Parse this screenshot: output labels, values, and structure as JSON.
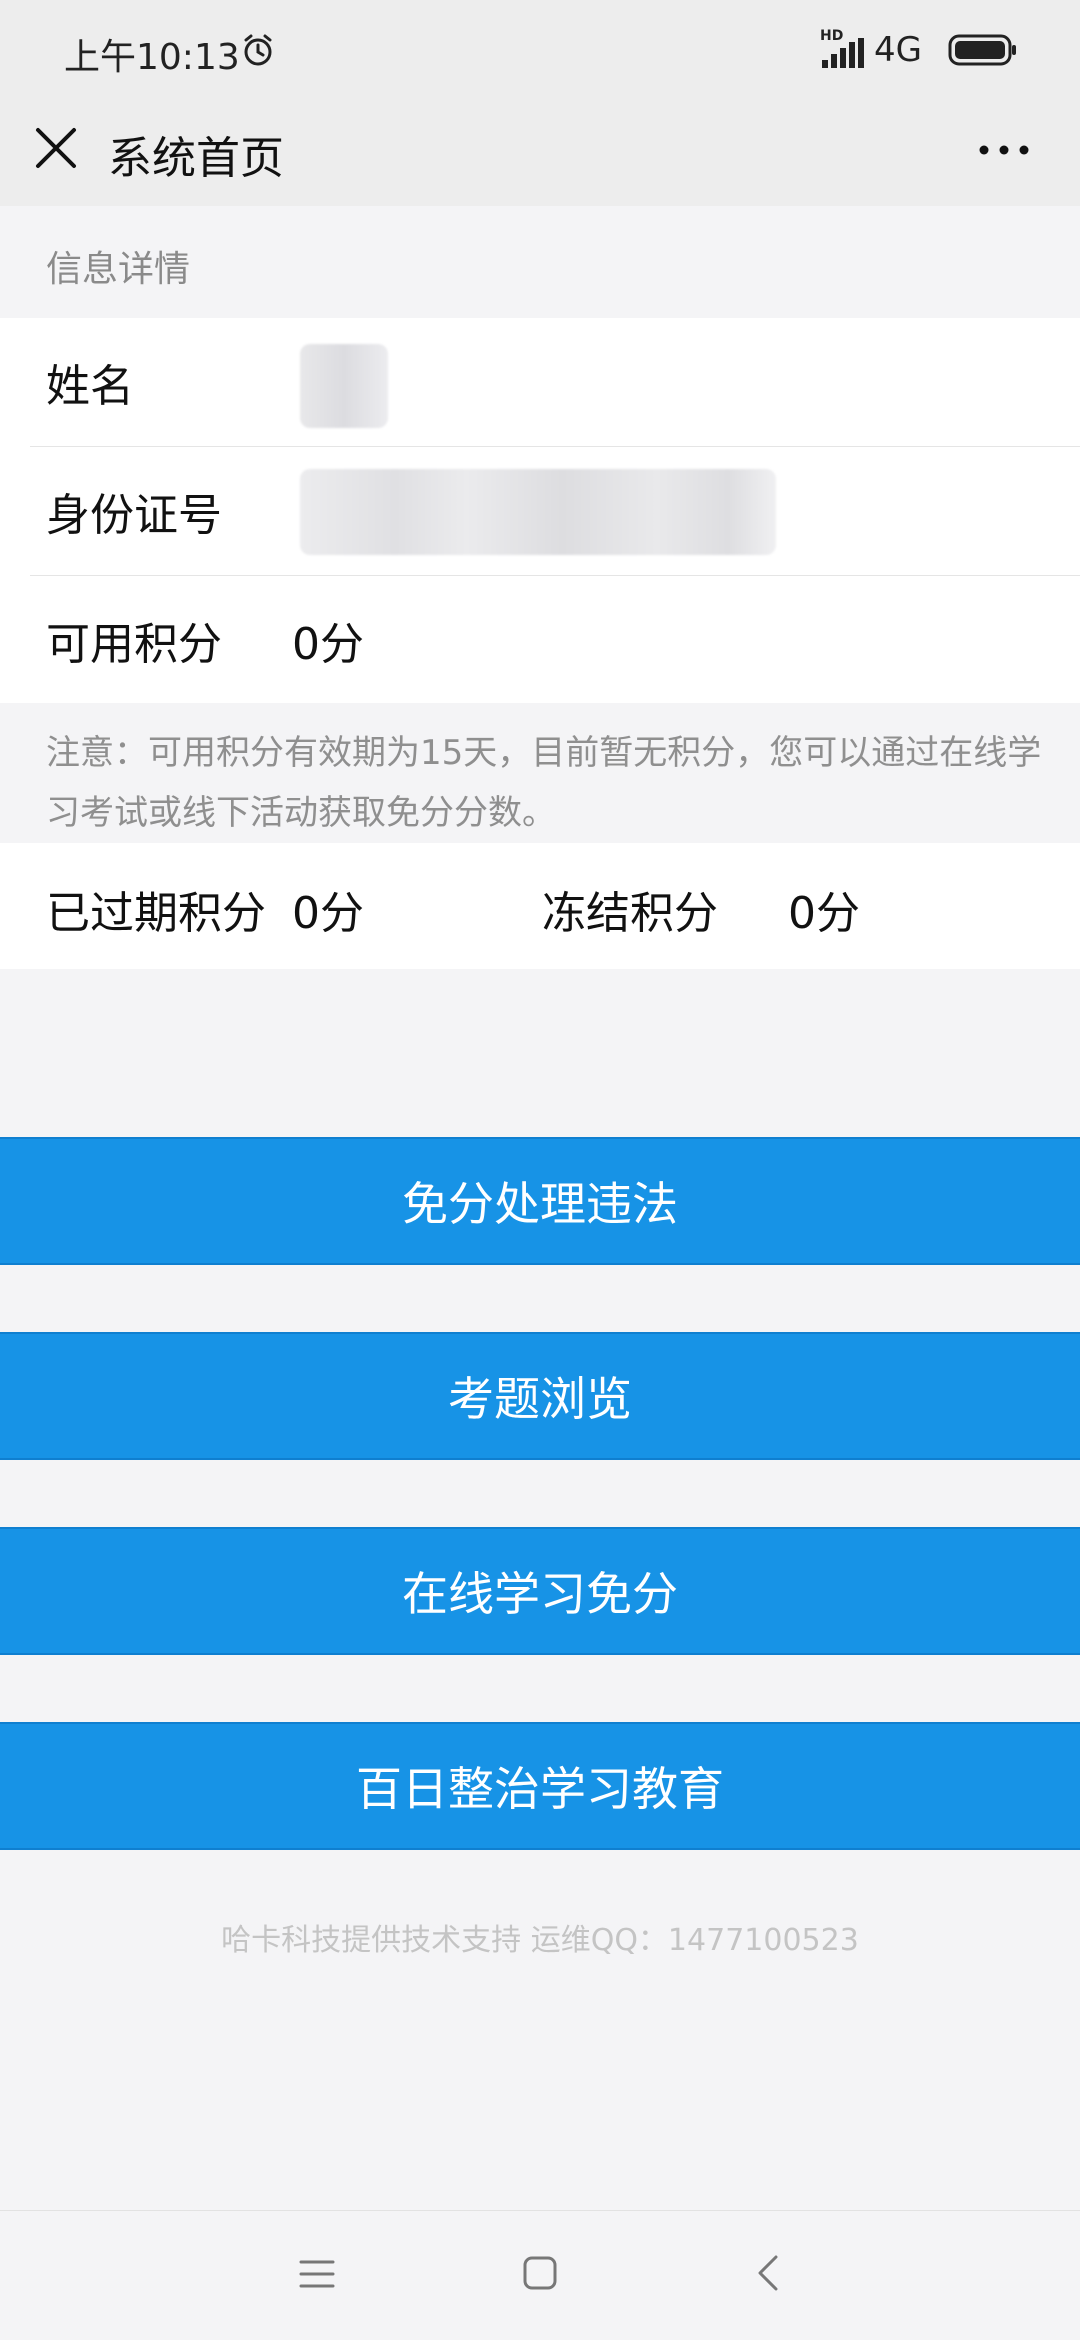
{
  "status_bar": {
    "time": "上午10:13",
    "hd": "HD",
    "network": "4G",
    "icons": [
      "alarm-icon",
      "signal-icon",
      "battery-icon"
    ]
  },
  "nav": {
    "title": "系统首页",
    "icons": [
      "close-icon",
      "more-icon"
    ]
  },
  "section": {
    "title": "信息详情"
  },
  "info": {
    "name_label": "姓名",
    "id_label": "身份证号",
    "points_label": "可用积分",
    "points_value": "0分"
  },
  "notice": "注意：可用积分有效期为15天，目前暂无积分，您可以通过在线学习考试或线下活动获取免分分数。",
  "points": {
    "expired_label": "已过期积分",
    "expired_value": "0分",
    "frozen_label": "冻结积分",
    "frozen_value": "0分"
  },
  "buttons": [
    {
      "label": "免分处理违法"
    },
    {
      "label": "考题浏览"
    },
    {
      "label": "在线学习免分"
    },
    {
      "label": "百日整治学习教育"
    }
  ],
  "footer": {
    "credit": "哈卡科技提供技术支持 运维QQ：1477100523"
  },
  "system_nav": {
    "icons": [
      "menu-icon",
      "home-icon",
      "back-icon"
    ]
  },
  "colors": {
    "primary_button": "#1793e6",
    "background": "#f4f4f6",
    "header": "#ededed"
  }
}
